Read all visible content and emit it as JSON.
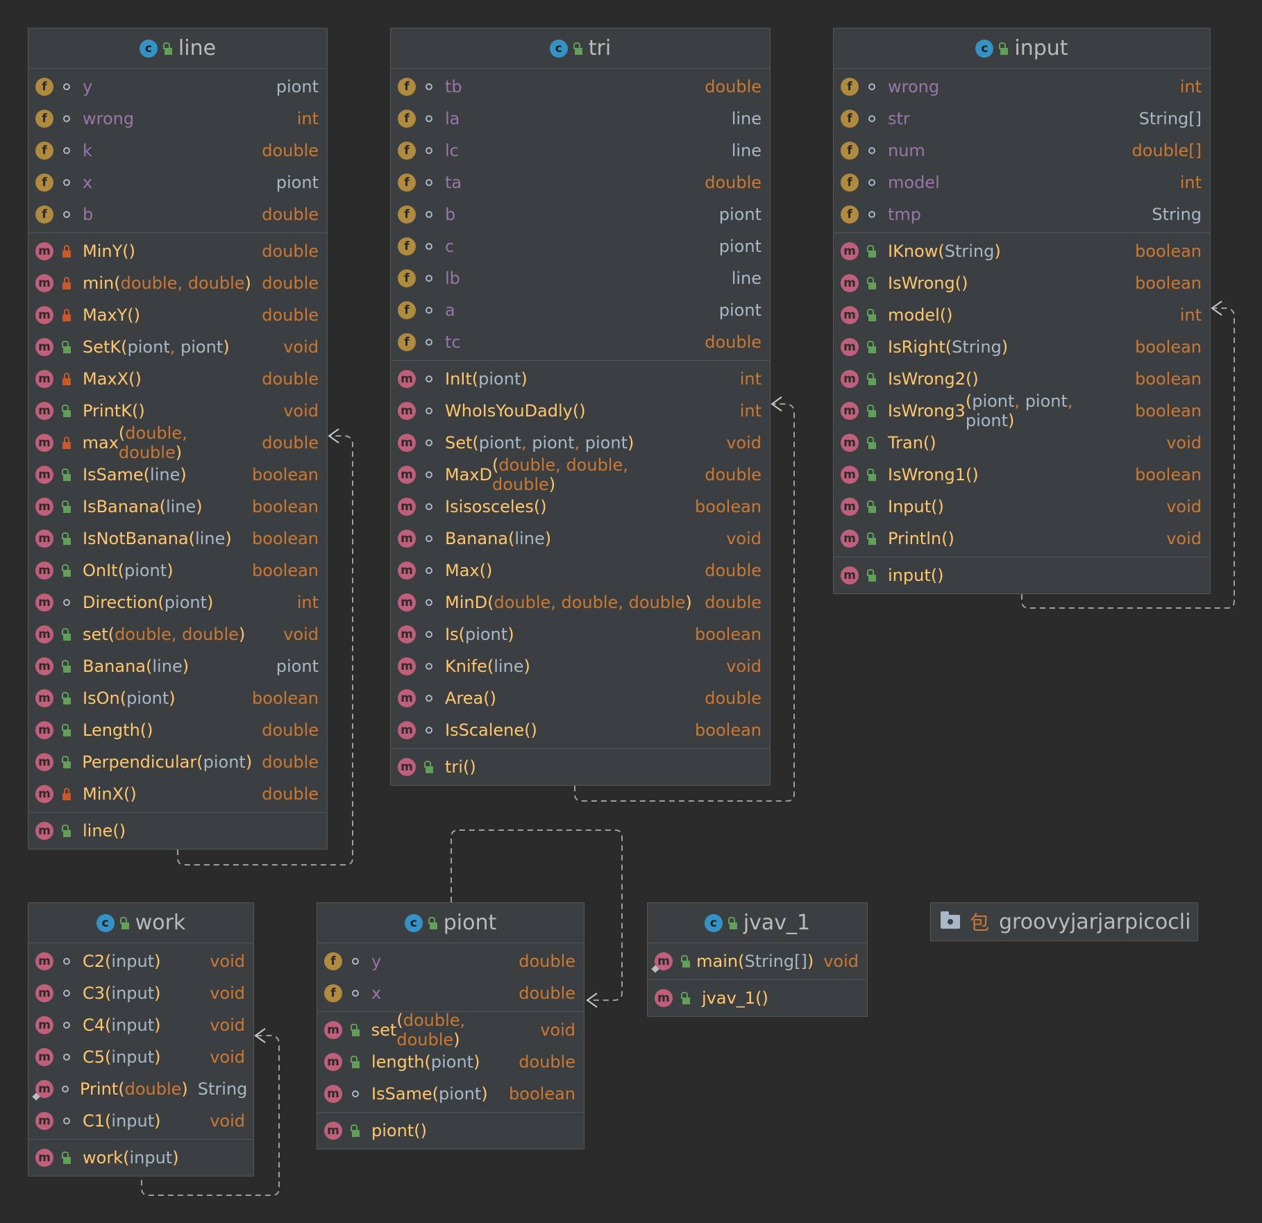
{
  "classes": [
    {
      "id": "line",
      "title": "line",
      "fields": [
        {
          "name": "y",
          "type": "piont",
          "prim": false,
          "vis": "pkg"
        },
        {
          "name": "wrong",
          "type": "int",
          "prim": true,
          "vis": "pkg"
        },
        {
          "name": "k",
          "type": "double",
          "prim": true,
          "vis": "pkg"
        },
        {
          "name": "x",
          "type": "piont",
          "prim": false,
          "vis": "pkg"
        },
        {
          "name": "b",
          "type": "double",
          "prim": true,
          "vis": "pkg"
        }
      ],
      "methods": [
        {
          "name": "MinY",
          "params": [],
          "type": "double",
          "prim": true,
          "vis": "private"
        },
        {
          "name": "min",
          "params": [
            "double",
            "double"
          ],
          "type": "double",
          "prim": true,
          "vis": "private"
        },
        {
          "name": "MaxY",
          "params": [],
          "type": "double",
          "prim": true,
          "vis": "private"
        },
        {
          "name": "SetK",
          "params": [
            "piont",
            "piont"
          ],
          "type": "void",
          "prim": true,
          "vis": "public"
        },
        {
          "name": "MaxX",
          "params": [],
          "type": "double",
          "prim": true,
          "vis": "private"
        },
        {
          "name": "PrintK",
          "params": [],
          "type": "void",
          "prim": true,
          "vis": "public"
        },
        {
          "name": "max",
          "params": [
            "double",
            "double"
          ],
          "type": "double",
          "prim": true,
          "vis": "private"
        },
        {
          "name": "IsSame",
          "params": [
            "line"
          ],
          "type": "boolean",
          "prim": true,
          "vis": "public"
        },
        {
          "name": "IsBanana",
          "params": [
            "line"
          ],
          "type": "boolean",
          "prim": true,
          "vis": "public"
        },
        {
          "name": "IsNotBanana",
          "params": [
            "line"
          ],
          "type": "boolean",
          "prim": true,
          "vis": "public"
        },
        {
          "name": "OnIt",
          "params": [
            "piont"
          ],
          "type": "boolean",
          "prim": true,
          "vis": "public"
        },
        {
          "name": "Direction",
          "params": [
            "piont"
          ],
          "type": "int",
          "prim": true,
          "vis": "pkg"
        },
        {
          "name": "set",
          "params": [
            "double",
            "double"
          ],
          "type": "void",
          "prim": true,
          "vis": "public"
        },
        {
          "name": "Banana",
          "params": [
            "line"
          ],
          "type": "piont",
          "prim": false,
          "vis": "public"
        },
        {
          "name": "IsOn",
          "params": [
            "piont"
          ],
          "type": "boolean",
          "prim": true,
          "vis": "public"
        },
        {
          "name": "Length",
          "params": [],
          "type": "double",
          "prim": true,
          "vis": "public"
        },
        {
          "name": "Perpendicular",
          "params": [
            "piont"
          ],
          "type": "double",
          "prim": true,
          "vis": "public"
        },
        {
          "name": "MinX",
          "params": [],
          "type": "double",
          "prim": true,
          "vis": "private"
        }
      ],
      "constructors": [
        {
          "name": "line",
          "params": [],
          "type": "",
          "prim": false,
          "vis": "public"
        }
      ]
    },
    {
      "id": "tri",
      "title": "tri",
      "fields": [
        {
          "name": "tb",
          "type": "double",
          "prim": true,
          "vis": "pkg"
        },
        {
          "name": "la",
          "type": "line",
          "prim": false,
          "vis": "pkg"
        },
        {
          "name": "lc",
          "type": "line",
          "prim": false,
          "vis": "pkg"
        },
        {
          "name": "ta",
          "type": "double",
          "prim": true,
          "vis": "pkg"
        },
        {
          "name": "b",
          "type": "piont",
          "prim": false,
          "vis": "pkg"
        },
        {
          "name": "c",
          "type": "piont",
          "prim": false,
          "vis": "pkg"
        },
        {
          "name": "lb",
          "type": "line",
          "prim": false,
          "vis": "pkg"
        },
        {
          "name": "a",
          "type": "piont",
          "prim": false,
          "vis": "pkg"
        },
        {
          "name": "tc",
          "type": "double",
          "prim": true,
          "vis": "pkg"
        }
      ],
      "methods": [
        {
          "name": "InIt",
          "params": [
            "piont"
          ],
          "type": "int",
          "prim": true,
          "vis": "pkg"
        },
        {
          "name": "WhoIsYouDadly",
          "params": [],
          "type": "int",
          "prim": true,
          "vis": "pkg"
        },
        {
          "name": "Set",
          "params": [
            "piont",
            "piont",
            "piont"
          ],
          "type": "void",
          "prim": true,
          "vis": "pkg"
        },
        {
          "name": "MaxD",
          "params": [
            "double",
            "double",
            "double"
          ],
          "type": "double",
          "prim": true,
          "vis": "pkg"
        },
        {
          "name": "Isisosceles",
          "params": [],
          "type": "boolean",
          "prim": true,
          "vis": "pkg"
        },
        {
          "name": "Banana",
          "params": [
            "line"
          ],
          "type": "void",
          "prim": true,
          "vis": "pkg"
        },
        {
          "name": "Max",
          "params": [],
          "type": "double",
          "prim": true,
          "vis": "pkg"
        },
        {
          "name": "MinD",
          "params": [
            "double",
            "double",
            "double"
          ],
          "type": "double",
          "prim": true,
          "vis": "pkg"
        },
        {
          "name": "Is",
          "params": [
            "piont"
          ],
          "type": "boolean",
          "prim": true,
          "vis": "pkg"
        },
        {
          "name": "Knife",
          "params": [
            "line"
          ],
          "type": "void",
          "prim": true,
          "vis": "pkg"
        },
        {
          "name": "Area",
          "params": [],
          "type": "double",
          "prim": true,
          "vis": "pkg"
        },
        {
          "name": "IsScalene",
          "params": [],
          "type": "boolean",
          "prim": true,
          "vis": "pkg"
        }
      ],
      "constructors": [
        {
          "name": "tri",
          "params": [],
          "type": "",
          "prim": false,
          "vis": "public"
        }
      ]
    },
    {
      "id": "input",
      "title": "input",
      "fields": [
        {
          "name": "wrong",
          "type": "int",
          "prim": true,
          "vis": "pkg"
        },
        {
          "name": "str",
          "type": "String[]",
          "prim": false,
          "vis": "pkg"
        },
        {
          "name": "num",
          "type": "double[]",
          "prim": true,
          "vis": "pkg"
        },
        {
          "name": "model",
          "type": "int",
          "prim": true,
          "vis": "pkg"
        },
        {
          "name": "tmp",
          "type": "String",
          "prim": false,
          "vis": "pkg"
        }
      ],
      "methods": [
        {
          "name": "IKnow",
          "params": [
            "String"
          ],
          "type": "boolean",
          "prim": true,
          "vis": "public"
        },
        {
          "name": "IsWrong",
          "params": [],
          "type": "boolean",
          "prim": true,
          "vis": "public"
        },
        {
          "name": "model",
          "params": [],
          "type": "int",
          "prim": true,
          "vis": "public"
        },
        {
          "name": "IsRight",
          "params": [
            "String"
          ],
          "type": "boolean",
          "prim": true,
          "vis": "public"
        },
        {
          "name": "IsWrong2",
          "params": [],
          "type": "boolean",
          "prim": true,
          "vis": "public"
        },
        {
          "name": "IsWrong3",
          "params": [
            "piont",
            "piont",
            "piont"
          ],
          "type": "boolean",
          "prim": true,
          "vis": "public"
        },
        {
          "name": "Tran",
          "params": [],
          "type": "void",
          "prim": true,
          "vis": "public"
        },
        {
          "name": "IsWrong1",
          "params": [],
          "type": "boolean",
          "prim": true,
          "vis": "public"
        },
        {
          "name": "Input",
          "params": [],
          "type": "void",
          "prim": true,
          "vis": "public"
        },
        {
          "name": "Println",
          "params": [],
          "type": "void",
          "prim": true,
          "vis": "public"
        }
      ],
      "constructors": [
        {
          "name": "input",
          "params": [],
          "type": "",
          "prim": false,
          "vis": "public"
        }
      ]
    },
    {
      "id": "work",
      "title": "work",
      "fields": [],
      "methods": [
        {
          "name": "C2",
          "params": [
            "input"
          ],
          "type": "void",
          "prim": true,
          "vis": "pkg"
        },
        {
          "name": "C3",
          "params": [
            "input"
          ],
          "type": "void",
          "prim": true,
          "vis": "pkg"
        },
        {
          "name": "C4",
          "params": [
            "input"
          ],
          "type": "void",
          "prim": true,
          "vis": "pkg"
        },
        {
          "name": "C5",
          "params": [
            "input"
          ],
          "type": "void",
          "prim": true,
          "vis": "pkg"
        },
        {
          "name": "Print",
          "params": [
            "double"
          ],
          "type": "String",
          "prim": false,
          "vis": "pkg",
          "static": true
        },
        {
          "name": "C1",
          "params": [
            "input"
          ],
          "type": "void",
          "prim": true,
          "vis": "pkg"
        }
      ],
      "constructors": [
        {
          "name": "work",
          "params": [
            "input"
          ],
          "type": "",
          "prim": false,
          "vis": "public"
        }
      ]
    },
    {
      "id": "piont",
      "title": "piont",
      "fields": [
        {
          "name": "y",
          "type": "double",
          "prim": true,
          "vis": "pkg"
        },
        {
          "name": "x",
          "type": "double",
          "prim": true,
          "vis": "pkg"
        }
      ],
      "methods": [
        {
          "name": "set",
          "params": [
            "double",
            "double"
          ],
          "type": "void",
          "prim": true,
          "vis": "public"
        },
        {
          "name": "length",
          "params": [
            "piont"
          ],
          "type": "double",
          "prim": true,
          "vis": "public"
        },
        {
          "name": "IsSame",
          "params": [
            "piont"
          ],
          "type": "boolean",
          "prim": true,
          "vis": "pkg"
        }
      ],
      "constructors": [
        {
          "name": "piont",
          "params": [],
          "type": "",
          "prim": false,
          "vis": "public"
        }
      ]
    },
    {
      "id": "jvav_1",
      "title": "jvav_1",
      "fields": [],
      "methods": [
        {
          "name": "main",
          "params": [
            "String[]"
          ],
          "type": "void",
          "prim": true,
          "vis": "public",
          "static": true
        }
      ],
      "constructors": [
        {
          "name": "jvav_1",
          "params": [],
          "type": "",
          "prim": false,
          "vis": "public"
        }
      ]
    }
  ],
  "package": {
    "glyph": "包",
    "name": "groovyjarjarpicocli"
  },
  "colors": {
    "background": "#2b2b2b",
    "box": "#3c3f41",
    "border": "#555555",
    "field_name": "#9876aa",
    "method_name": "#ffc66d",
    "keyword": "#cc7832",
    "text": "#a9b7c6",
    "class_icon": "#3592c4",
    "field_badge": "#b08a3e",
    "method_badge": "#c05f7b"
  }
}
